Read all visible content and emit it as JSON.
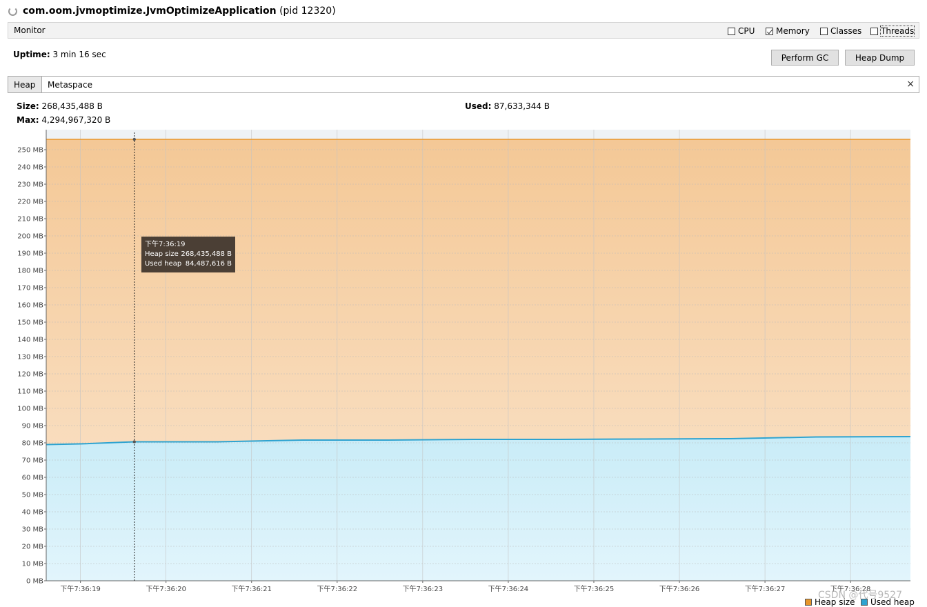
{
  "window": {
    "title_main": "com.oom.jvmoptimize.JvmOptimizeApplication",
    "title_pid": "(pid 12320)",
    "spinner_icon": "loading-icon"
  },
  "monitor": {
    "label": "Monitor",
    "checkboxes": [
      {
        "label": "CPU",
        "checked": false
      },
      {
        "label": "Memory",
        "checked": true
      },
      {
        "label": "Classes",
        "checked": false
      },
      {
        "label": "Threads",
        "checked": false
      }
    ],
    "uptime_label": "Uptime:",
    "uptime_value": "3 min 16 sec",
    "perform_gc": "Perform GC",
    "heap_dump": "Heap Dump"
  },
  "tabs": [
    {
      "label": "Heap",
      "active": true
    },
    {
      "label": "Metaspace",
      "active": false
    }
  ],
  "close_glyph": "×",
  "stats": {
    "size_label": "Size:",
    "size_value": "268,435,488 B",
    "max_label": "Max:",
    "max_value": "4,294,967,320 B",
    "used_label": "Used:",
    "used_value": "87,633,344 B"
  },
  "tooltip": {
    "time": "下午7:36:19",
    "heap_size_label": "Heap size",
    "heap_size_value": "268,435,488 B",
    "used_heap_label": "Used heap",
    "used_heap_value": "84,487,616 B"
  },
  "legend": {
    "heap_size": "Heap size",
    "used_heap": "Used heap"
  },
  "watermark": "CSDN @代号9527",
  "colors": {
    "heap_line": "#e8962a",
    "heap_fill_top": "#f4c896",
    "heap_fill_bottom": "#fbe6cf",
    "used_line": "#2ea3d0",
    "used_fill_top": "#c9ecf7",
    "used_fill_bottom": "#e2f5fc"
  },
  "chart_data": {
    "type": "area",
    "ylim": [
      0,
      260
    ],
    "y_ticks": [
      "0 MB",
      "10 MB",
      "20 MB",
      "30 MB",
      "40 MB",
      "50 MB",
      "60 MB",
      "70 MB",
      "80 MB",
      "90 MB",
      "100 MB",
      "110 MB",
      "120 MB",
      "130 MB",
      "140 MB",
      "150 MB",
      "160 MB",
      "170 MB",
      "180 MB",
      "190 MB",
      "200 MB",
      "210 MB",
      "220 MB",
      "230 MB",
      "240 MB",
      "250 MB"
    ],
    "y_tick_values": [
      0,
      10,
      20,
      30,
      40,
      50,
      60,
      70,
      80,
      90,
      100,
      110,
      120,
      130,
      140,
      150,
      160,
      170,
      180,
      190,
      200,
      210,
      220,
      230,
      240,
      250
    ],
    "x_ticks": [
      "下午7:36:19",
      "下午7:36:20",
      "下午7:36:21",
      "下午7:36:22",
      "下午7:36:23",
      "下午7:36:24",
      "下午7:36:25",
      "下午7:36:26",
      "下午7:36:27",
      "下午7:36:28"
    ],
    "xlim": [
      18.6,
      28.7
    ],
    "x_tick_values": [
      19,
      20,
      21,
      22,
      23,
      24,
      25,
      26,
      27,
      28
    ],
    "cursor_x": 19.63,
    "series": [
      {
        "name": "Heap size",
        "x": [
          18.6,
          19.63,
          28.7
        ],
        "y": [
          256,
          256,
          256
        ]
      },
      {
        "name": "Used heap",
        "x": [
          18.6,
          19.0,
          19.63,
          20.6,
          21.6,
          22.6,
          23.6,
          24.6,
          25.6,
          26.6,
          27.6,
          28.7
        ],
        "y": [
          79,
          79.4,
          80.6,
          80.6,
          81.6,
          81.6,
          82,
          82,
          82.2,
          82.4,
          83.4,
          83.6
        ]
      }
    ]
  }
}
